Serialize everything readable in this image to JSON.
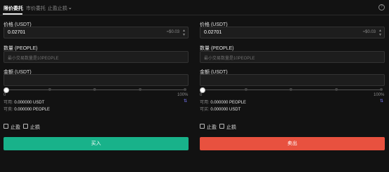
{
  "tabs": {
    "limit": "限价委托",
    "market": "市价委托",
    "stop": "止盈止损"
  },
  "buy": {
    "price_label": "价格 (USDT)",
    "price_value": "0.02701",
    "price_suffix": "≈$0.03",
    "qty_label": "数量 (PEOPLE)",
    "qty_placeholder": "最小交易数量是10PEOPLE",
    "amount_label": "金额 (USDT)",
    "slider_min": "0",
    "slider_max": "100%",
    "swap_icon_text": "⇅",
    "avail1_label": "可用:",
    "avail1_value": "0.000000 USDT",
    "avail2_label": "可卖:",
    "avail2_value": "0.000000 PEOPLE",
    "tp_label": "止盈",
    "sl_label": "止损",
    "button": "买入"
  },
  "sell": {
    "price_label": "价格 (USDT)",
    "price_value": "0.02701",
    "price_suffix": "≈$0.03",
    "qty_label": "数量 (PEOPLE)",
    "qty_placeholder": "最小交易数量是10PEOPLE",
    "amount_label": "金额 (USDT)",
    "slider_min": "0",
    "slider_max": "100%",
    "swap_icon_text": "⇅",
    "avail1_label": "可用:",
    "avail1_value": "0.000000 PEOPLE",
    "avail2_label": "可买:",
    "avail2_value": "0.000000 USDT",
    "tp_label": "止盈",
    "sl_label": "止损",
    "button": "卖出"
  },
  "colors": {
    "buy": "#18b28a",
    "sell": "#e8513f",
    "background": "#121212"
  },
  "icons": {
    "dropdown": "chevron-down-icon",
    "info": "info-icon",
    "step_up": "step-up-icon",
    "step_down": "step-down-icon",
    "swap": "swap-icon"
  }
}
